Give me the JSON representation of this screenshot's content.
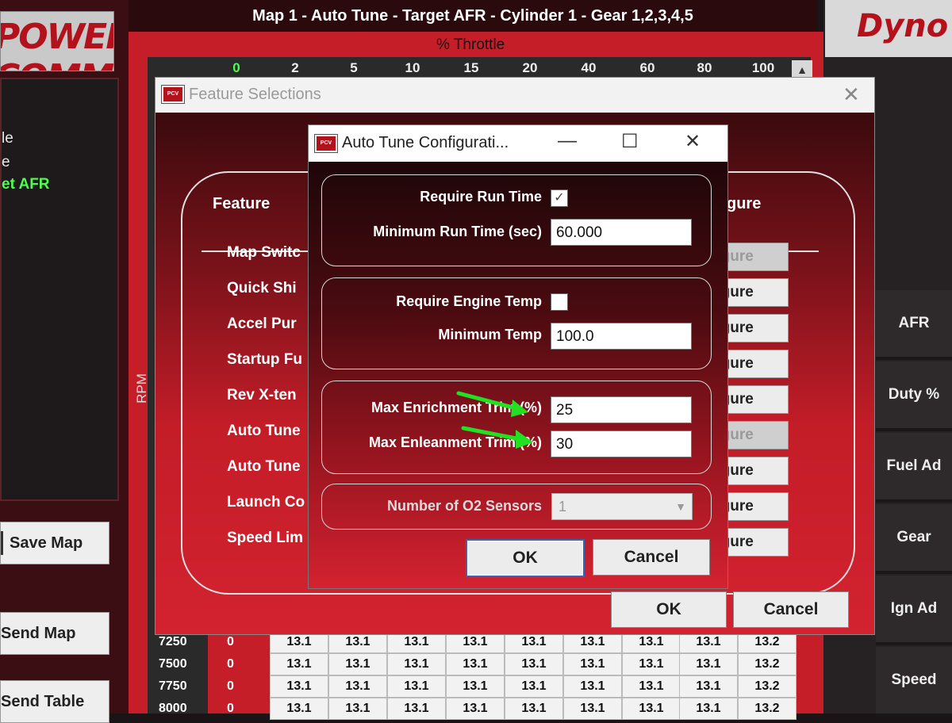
{
  "left_panel": {
    "logo_text": "POWER COMMANDER V",
    "nav_items": [
      {
        "label": "le",
        "active": false
      },
      {
        "label": "e",
        "active": false
      },
      {
        "label": "et AFR",
        "active": true
      }
    ],
    "buttons": {
      "save_map": "Save Map",
      "send_map": "Send Map",
      "send_table": "Send Table"
    }
  },
  "map": {
    "title": "Map 1 - Auto Tune - Target AFR - Cylinder 1 - Gear 1,2,3,4,5",
    "x_axis_label": "% Throttle",
    "y_axis_label": "RPM",
    "throttle_columns": [
      "0",
      "2",
      "5",
      "10",
      "15",
      "20",
      "40",
      "60",
      "80",
      "100"
    ],
    "rows": [
      {
        "rpm": "7250",
        "zero": "0",
        "values": [
          "13.1",
          "13.1",
          "13.1",
          "13.1",
          "13.1",
          "13.1",
          "13.1",
          "13.1",
          "13.2"
        ]
      },
      {
        "rpm": "7500",
        "zero": "0",
        "values": [
          "13.1",
          "13.1",
          "13.1",
          "13.1",
          "13.1",
          "13.1",
          "13.1",
          "13.1",
          "13.2"
        ]
      },
      {
        "rpm": "7750",
        "zero": "0",
        "values": [
          "13.1",
          "13.1",
          "13.1",
          "13.1",
          "13.1",
          "13.1",
          "13.1",
          "13.1",
          "13.2"
        ]
      },
      {
        "rpm": "8000",
        "zero": "0",
        "values": [
          "13.1",
          "13.1",
          "13.1",
          "13.1",
          "13.1",
          "13.1",
          "13.1",
          "13.1",
          "13.2"
        ]
      }
    ]
  },
  "right_panel": {
    "brand_text": "Dyno",
    "gauges": [
      "AFR",
      "Duty %",
      "Fuel Ad",
      "Gear",
      "Ign Ad",
      "Speed"
    ]
  },
  "feature_dialog": {
    "title": "Feature Selections",
    "header_feature": "Feature",
    "header_configure": "gure",
    "features": [
      {
        "name": "Map Switc",
        "button": "figure",
        "enabled": false
      },
      {
        "name": "Quick Shi",
        "button": "figure",
        "enabled": true
      },
      {
        "name": "Accel Pur",
        "button": "figure",
        "enabled": true
      },
      {
        "name": "Startup Fu",
        "button": "figure",
        "enabled": true
      },
      {
        "name": "Rev X-ten",
        "button": "figure",
        "enabled": true
      },
      {
        "name": "Auto Tune",
        "button": "figure",
        "enabled": false
      },
      {
        "name": "Auto Tune",
        "button": "figure",
        "enabled": true
      },
      {
        "name": "Launch Co",
        "button": "figure",
        "enabled": true
      },
      {
        "name": "Speed Lim",
        "button": "figure",
        "enabled": true
      }
    ],
    "ok": "OK",
    "cancel": "Cancel"
  },
  "autotune_dialog": {
    "title": "Auto Tune Configurati...",
    "window_controls": {
      "minimize": "—",
      "maximize": "☐",
      "close": "✕"
    },
    "require_run_time": {
      "label": "Require Run Time",
      "checked": true
    },
    "min_run_time": {
      "label": "Minimum Run Time (sec)",
      "value": "60.000"
    },
    "require_engine_temp": {
      "label": "Require Engine Temp",
      "checked": false
    },
    "min_temp": {
      "label": "Minimum Temp",
      "value": "100.0"
    },
    "max_enrichment": {
      "label": "Max Enrichment Trim (%)",
      "value": "25"
    },
    "max_enleanment": {
      "label": "Max Enleanment Trim (%)",
      "value": "30"
    },
    "o2_sensors": {
      "label": "Number of O2 Sensors",
      "value": "1"
    },
    "ok": "OK",
    "cancel": "Cancel"
  },
  "colors": {
    "accent_red": "#c41d28",
    "active_green": "#4dff4d",
    "annotation_arrow": "#22e022"
  }
}
